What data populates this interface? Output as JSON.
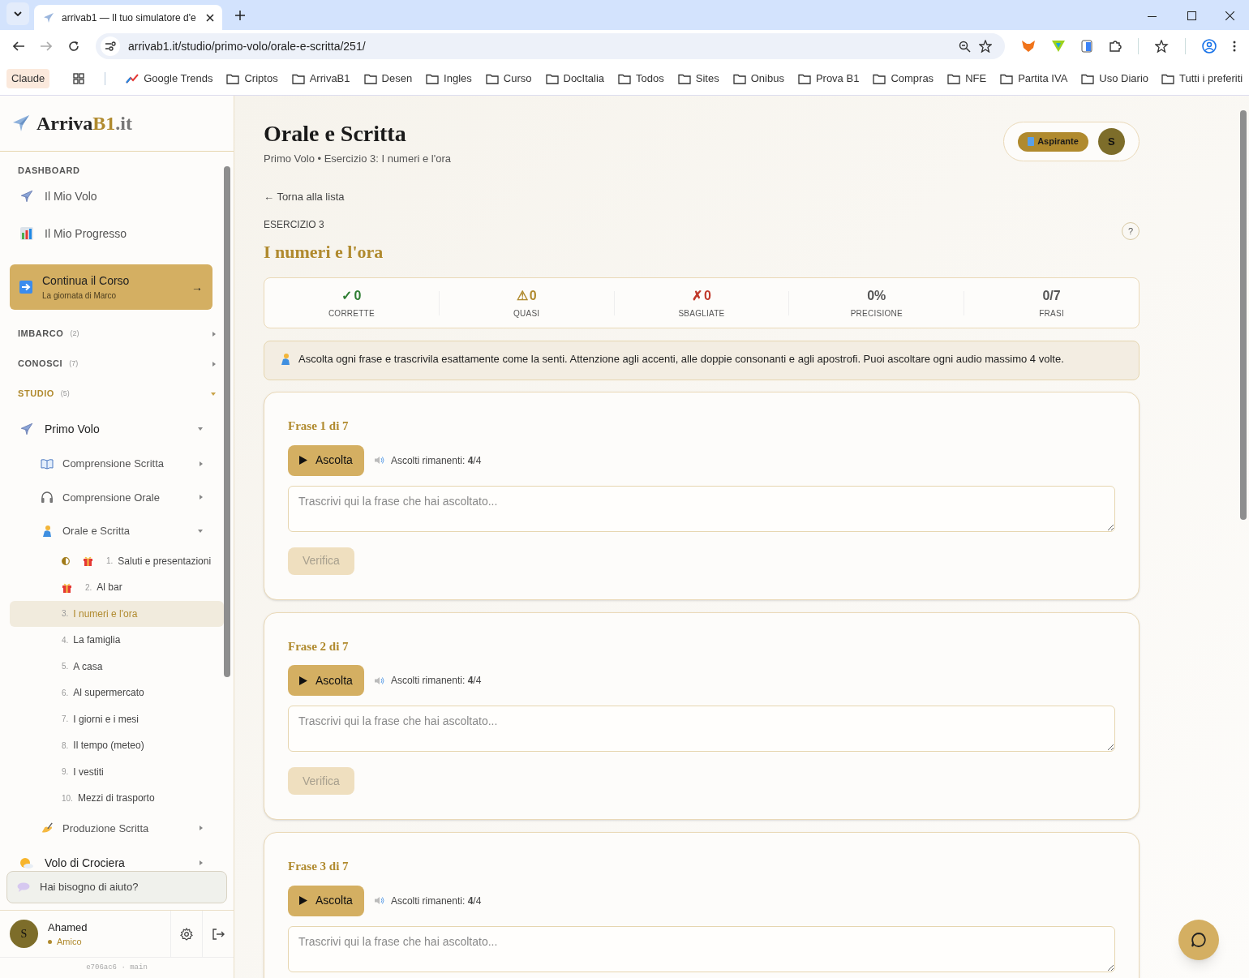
{
  "browser": {
    "tab_title": "arrivab1 — Il tuo simulatore d'e",
    "url": "arrivab1.it/studio/primo-volo/orale-e-scritta/251/",
    "bookmarks": [
      {
        "label": "Claude",
        "kind": "chip"
      },
      {
        "label": "Google Trends",
        "kind": "trend"
      },
      {
        "label": "Criptos",
        "kind": "folder"
      },
      {
        "label": "ArrivaB1",
        "kind": "folder"
      },
      {
        "label": "Desen",
        "kind": "folder"
      },
      {
        "label": "Ingles",
        "kind": "folder"
      },
      {
        "label": "Curso",
        "kind": "folder"
      },
      {
        "label": "DocItalia",
        "kind": "folder"
      },
      {
        "label": "Todos",
        "kind": "folder"
      },
      {
        "label": "Sites",
        "kind": "folder"
      },
      {
        "label": "Onibus",
        "kind": "folder"
      },
      {
        "label": "Prova B1",
        "kind": "folder"
      },
      {
        "label": "Compras",
        "kind": "folder"
      },
      {
        "label": "NFE",
        "kind": "folder"
      },
      {
        "label": "Partita IVA",
        "kind": "folder"
      },
      {
        "label": "Uso Diario",
        "kind": "folder"
      }
    ],
    "all_bookmarks": "Tutti i preferiti"
  },
  "sidebar": {
    "logo": {
      "main": "Arriva",
      "accent": "B1",
      "suffix": ".it"
    },
    "section": "DASHBOARD",
    "nav": [
      {
        "label": "Il Mio Volo",
        "kind": "plane"
      },
      {
        "label": "Il Mio Progresso",
        "kind": "chart"
      }
    ],
    "continue": {
      "title": "Continua il Corso",
      "subtitle": "La giornata di Marco",
      "arrow": "→"
    },
    "categories": [
      {
        "label": "IMBARCO",
        "count": "(2)",
        "expanded": false
      },
      {
        "label": "CONOSCI",
        "count": "(7)",
        "expanded": false
      },
      {
        "label": "STUDIO",
        "count": "(5)",
        "expanded": true
      }
    ],
    "tree": [
      {
        "label": "Primo Volo",
        "kind": "plane",
        "expanded": true,
        "children": [
          {
            "label": "Comprensione Scritta",
            "kind": "book",
            "expanded": false
          },
          {
            "label": "Comprensione Orale",
            "kind": "headphones",
            "expanded": false
          },
          {
            "label": "Orale e Scritta",
            "kind": "person",
            "expanded": true,
            "children": [
              {
                "number": "1.",
                "label": "Saluti e presentazioni",
                "half_done": true,
                "gift": true,
                "selected": false
              },
              {
                "number": "2.",
                "label": "Al bar",
                "half_done": false,
                "gift": true,
                "selected": false
              },
              {
                "number": "3.",
                "label": "I numeri e l'ora",
                "half_done": false,
                "gift": false,
                "selected": true
              },
              {
                "number": "4.",
                "label": "La famiglia",
                "half_done": false,
                "gift": false,
                "selected": false
              },
              {
                "number": "5.",
                "label": "A casa",
                "half_done": false,
                "gift": false,
                "selected": false
              },
              {
                "number": "6.",
                "label": "Al supermercato",
                "half_done": false,
                "gift": false,
                "selected": false
              },
              {
                "number": "7.",
                "label": "I giorni e i mesi",
                "half_done": false,
                "gift": false,
                "selected": false
              },
              {
                "number": "8.",
                "label": "Il tempo (meteo)",
                "half_done": false,
                "gift": false,
                "selected": false
              },
              {
                "number": "9.",
                "label": "I vestiti",
                "half_done": false,
                "gift": false,
                "selected": false
              },
              {
                "number": "10.",
                "label": "Mezzi di trasporto",
                "half_done": false,
                "gift": false,
                "selected": false
              }
            ]
          },
          {
            "label": "Produzione Scritta",
            "kind": "hand",
            "expanded": false
          }
        ]
      },
      {
        "label": "Volo di Crociera",
        "kind": "sun",
        "expanded": false
      }
    ],
    "help": "Hai bisogno di aiuto?",
    "user": {
      "avatar": "S",
      "name": "Ahamed",
      "role": "Amico"
    },
    "version": "e706ac6 · main"
  },
  "header": {
    "title": "Orale e Scritta",
    "breadcrumb": "Primo Volo • Esercizio 3: I numeri e l'ora",
    "badge": "Aspirante",
    "avatar": "S"
  },
  "exercise": {
    "back": "← Torna alla lista",
    "eyebrow": "ESERCIZIO 3",
    "title": "I numeri e l'ora",
    "help": "?",
    "stats": [
      {
        "icon": "✓",
        "value": "0",
        "label": "CORRETTE",
        "kind": "correct"
      },
      {
        "icon": "⚠",
        "value": "0",
        "label": "QUASI",
        "kind": "almost"
      },
      {
        "icon": "✗",
        "value": "0",
        "label": "SBAGLIATE",
        "kind": "wrong"
      },
      {
        "value": "0%",
        "label": "PRECISIONE",
        "kind": "plain"
      },
      {
        "value": "0/7",
        "label": "FRASI",
        "kind": "plain"
      }
    ],
    "instructions": "Ascolta ogni frase e trascrivila esattamente come la senti. Attenzione agli accenti, alle doppie consonanti e agli apostrofi. Puoi ascoltare ogni audio massimo 4 volte.",
    "sentences": [
      {
        "title": "Frase 1 di 7",
        "play": "Ascolta",
        "remaining": "Ascolti rimanenti: **4**/4",
        "placeholder": "Trascrivi qui la frase che hai ascoltato...",
        "verify": "Verifica",
        "verify_disabled": true
      },
      {
        "title": "Frase 2 di 7",
        "play": "Ascolta",
        "remaining": "Ascolti rimanenti: **4**/4",
        "placeholder": "Trascrivi qui la frase che hai ascoltato...",
        "verify": "Verifica",
        "verify_disabled": true
      },
      {
        "title": "Frase 3 di 7",
        "play": "Ascolta",
        "remaining": "Ascolti rimanenti: **4**/4",
        "placeholder": "Trascrivi qui la frase che hai ascoltato..."
      }
    ]
  }
}
